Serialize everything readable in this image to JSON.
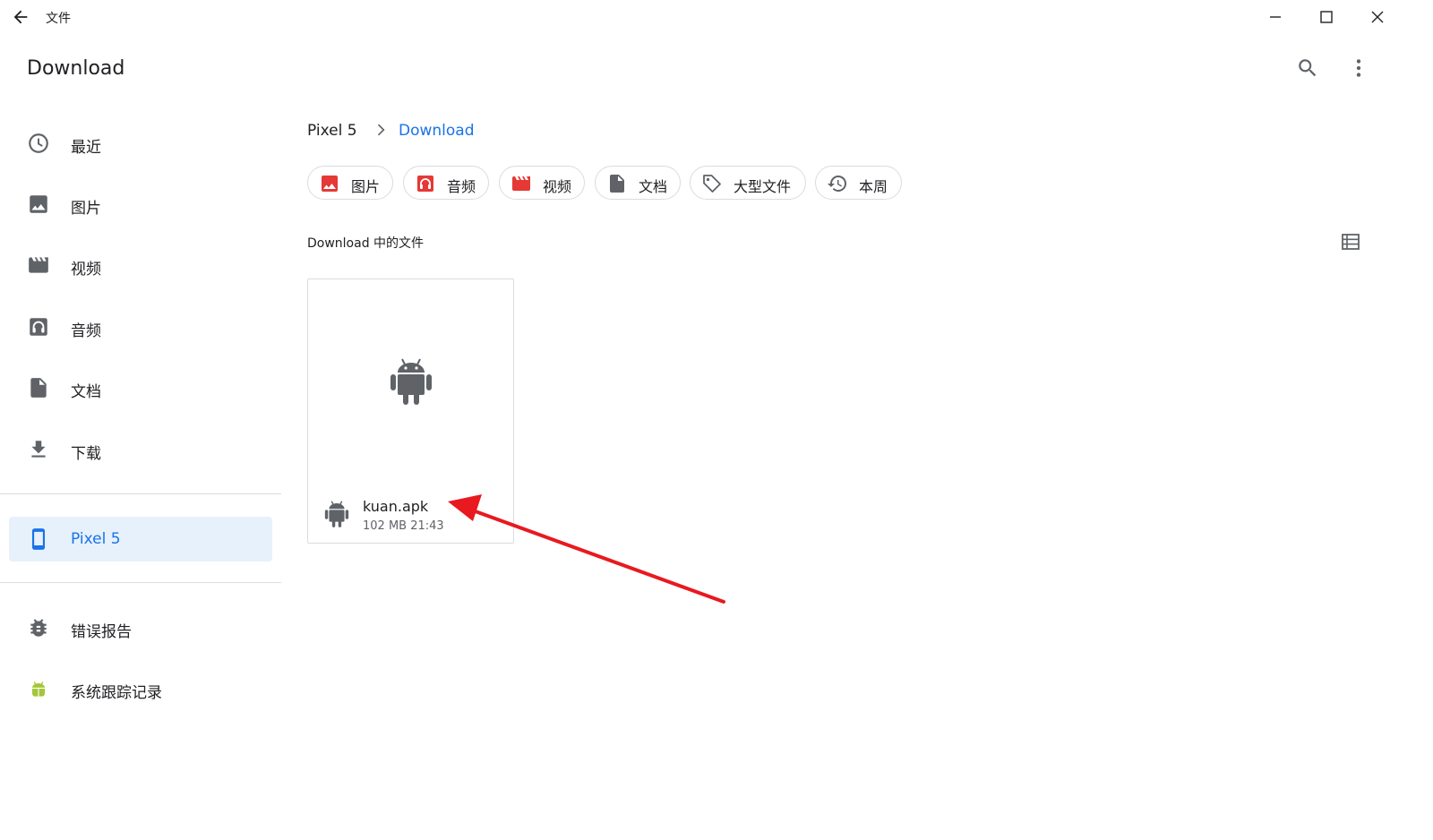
{
  "window": {
    "app_title": "文件",
    "back_icon": "arrow-left-icon",
    "controls": [
      "minimize-icon",
      "maximize-icon",
      "close-icon"
    ]
  },
  "appbar": {
    "title": "Download",
    "actions": [
      "search-icon",
      "more-vert-icon"
    ]
  },
  "sidebar": {
    "items": [
      {
        "label": "最近",
        "icon": "clock-icon"
      },
      {
        "label": "图片",
        "icon": "image-icon"
      },
      {
        "label": "视频",
        "icon": "movie-icon"
      },
      {
        "label": "音频",
        "icon": "headphones-icon"
      },
      {
        "label": "文档",
        "icon": "document-icon"
      },
      {
        "label": "下载",
        "icon": "download-icon"
      }
    ],
    "device": {
      "label": "Pixel 5",
      "icon": "phone-icon",
      "active": true
    },
    "extras": [
      {
        "label": "错误报告",
        "icon": "bug-icon"
      },
      {
        "label": "系统跟踪记录",
        "icon": "android-icon"
      }
    ]
  },
  "breadcrumb": {
    "root": "Pixel 5",
    "current": "Download"
  },
  "chips": [
    {
      "label": "图片",
      "icon": "image-icon"
    },
    {
      "label": "音频",
      "icon": "headphones-icon"
    },
    {
      "label": "视频",
      "icon": "movie-icon"
    },
    {
      "label": "文档",
      "icon": "document-icon"
    },
    {
      "label": "大型文件",
      "icon": "tag-icon"
    },
    {
      "label": "本周",
      "icon": "history-icon"
    }
  ],
  "section": {
    "title": "Download 中的文件",
    "view_toggle_icon": "list-view-icon"
  },
  "files": [
    {
      "name": "kuan.apk",
      "size": "102 MB",
      "time": "21:43",
      "meta": "102 MB 21:43",
      "icon": "android-icon"
    }
  ],
  "colors": {
    "accent": "#1a73e8",
    "active_bg": "#e6f1fb",
    "chip_icon_red": "#e53935",
    "icon_gray": "#5f6368",
    "android_green": "#a4c639",
    "annotation_red": "#e8191f"
  }
}
